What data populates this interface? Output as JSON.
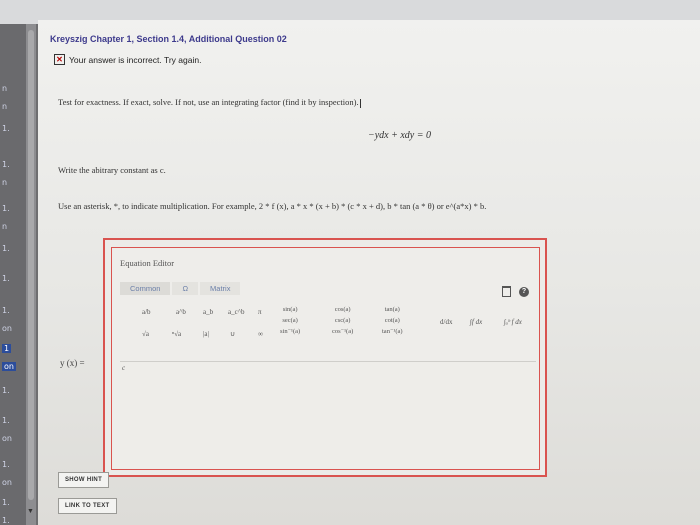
{
  "assignment": {
    "title": "Kreyszig Chapter 1, Section 1.4, Additional Question 02",
    "error_message": "Your answer is incorrect.  Try again.",
    "instruction": "Test for exactness. If exact, solve. If not, use an integrating factor (find it by inspection).",
    "equation": "−ydx + xdy = 0",
    "constant_note": "Write the abitrary constant as c.",
    "asterisk_note": "Use an asterisk, *, to indicate multiplication. For example, 2 * f (x), a * x * (x + b) * (c * x + d), b * tan (a * θ) or e^(a*x) * b."
  },
  "equation_editor": {
    "title": "Equation Editor",
    "tabs": [
      "Common",
      "Ω",
      "Matrix"
    ],
    "active_tab": "Common",
    "lhs_label": "y (x) =",
    "input_value": "c",
    "toolbar": {
      "fraction": "a/b",
      "power": "a^b",
      "subscript": "a_b",
      "sub_sup": "a_c^b",
      "pi": "π",
      "sqrt": "√a",
      "nth_root": "ⁿ√a",
      "abs": "|a|",
      "union": "∪",
      "infinity": "∞",
      "trig_col1": [
        "sin(a)",
        "sec(a)",
        "sin⁻¹(a)"
      ],
      "trig_col2": [
        "cos(a)",
        "csc(a)",
        "cos⁻¹(a)"
      ],
      "trig_col3": [
        "tan(a)",
        "cot(a)",
        "tan⁻¹(a)"
      ],
      "derivative": "d/dx",
      "integral": "∫f dx",
      "def_integral": "∫ₐᵇ f dx"
    }
  },
  "buttons": {
    "show_hint": "SHOW HINT",
    "link_to_text": "LINK TO TEXT"
  },
  "left_nav": [
    "n",
    "n",
    "1.",
    "1.",
    "n",
    "1.",
    "n",
    "1.",
    "1.",
    "1.",
    "on",
    "1",
    "on",
    "1.",
    "1.",
    "on",
    "1.",
    "on",
    "1.",
    "1."
  ]
}
